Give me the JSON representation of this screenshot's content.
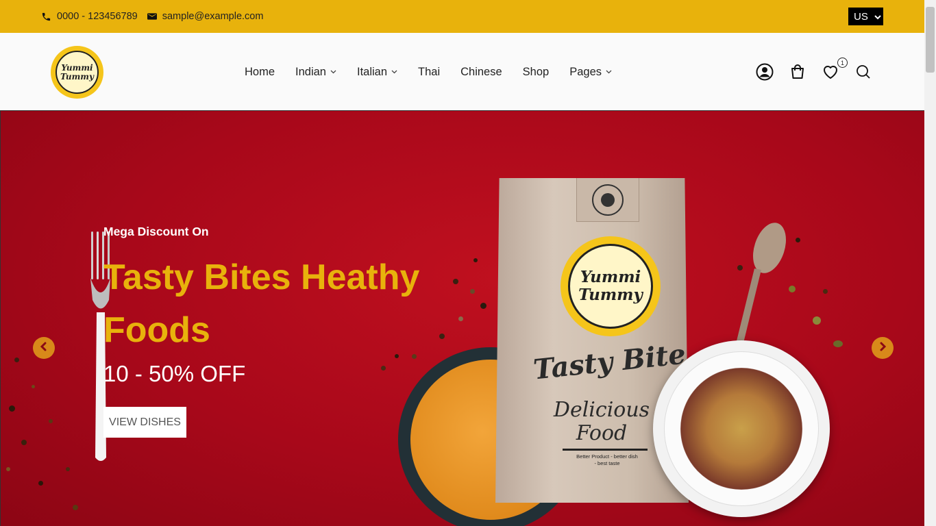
{
  "topbar": {
    "phone": "0000 - 123456789",
    "email": "sample@example.com",
    "language": "US"
  },
  "header": {
    "logo_line1": "Yummi",
    "logo_line2": "Tummy",
    "nav": [
      {
        "label": "Home",
        "dropdown": false
      },
      {
        "label": "Indian",
        "dropdown": true
      },
      {
        "label": "Italian",
        "dropdown": true
      },
      {
        "label": "Thai",
        "dropdown": false
      },
      {
        "label": "Chinese",
        "dropdown": false
      },
      {
        "label": "Shop",
        "dropdown": false
      },
      {
        "label": "Pages",
        "dropdown": true
      }
    ],
    "wishlist_count": "1"
  },
  "hero": {
    "eyebrow": "Mega Discount On",
    "headline": "Tasty Bites Heathy Foods",
    "offer": "10 - 50% OFF",
    "cta": "VIEW DISHES",
    "bag": {
      "logo_line1": "Yummi",
      "logo_line2": "Tummy",
      "script_title": "Tasty Bite",
      "script_sub": "Delicious Food",
      "tagline": "Better Product - better dish - best taste"
    }
  },
  "colors": {
    "accent": "#e8b20c",
    "hero_bg": "#b00a1b",
    "arrow": "#d8891a"
  }
}
